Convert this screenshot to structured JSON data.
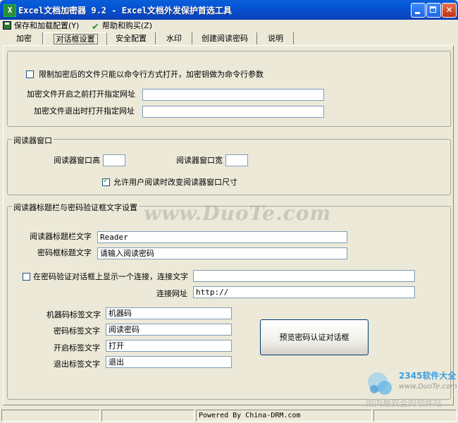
{
  "window": {
    "title": "Excel文档加密器 9.2 - Excel文档外发保护首选工具",
    "icon_text": "X"
  },
  "menu": {
    "items": [
      {
        "label": "保存和加载配置(Y)",
        "icon": "save-icon"
      },
      {
        "label": "帮助和购买(Z)",
        "icon": "help-icon"
      }
    ]
  },
  "tabs": [
    "加密",
    "对话框设置",
    "安全配置",
    "水印",
    "创建阅读密码",
    "说明"
  ],
  "active_tab": "对话框设置",
  "section_cmd": {
    "restrict_label": "限制加密后的文件只能以命令行方式打开，加密钥做为命令行参数",
    "restrict_checked": false,
    "open_url_label": "加密文件开启之前打开指定网址",
    "open_url_value": "",
    "exit_url_label": "加密文件退出时打开指定网址",
    "exit_url_value": ""
  },
  "reader_window": {
    "title": "阅读器窗口",
    "height_label": "阅读器窗口高",
    "height_value": "",
    "width_label": "阅读器窗口宽",
    "width_value": "",
    "allow_resize_label": "允许用户阅读时改变阅读器窗口尺寸",
    "allow_resize_checked": true
  },
  "title_text_settings": {
    "title": "阅读器标题栏与密码验证框文字设置",
    "reader_title_label": "阅读器标题栏文字",
    "reader_title_value": "Reader",
    "pwd_box_title_label": "密码框标题文字",
    "pwd_box_title_value": "请输入阅读密码",
    "show_link_label": "在密码验证对话框上显示一个连接，连接文字",
    "show_link_checked": false,
    "link_text_value": "",
    "link_url_label": "连接网址",
    "link_url_value": "http://",
    "machine_code_label": "机器码标签文字",
    "machine_code_value": "机器码",
    "password_label": "密码标签文字",
    "password_value": "阅读密码",
    "open_label": "开启标签文字",
    "open_value": "打开",
    "exit_label": "退出标签文字",
    "exit_value": "退出",
    "preview_button": "预览密码认证对话框"
  },
  "watermark": {
    "text": "www.DuoTe.com",
    "corner_brand": "2345软件大全",
    "corner_site": "www.DuoTe.com",
    "corner_slogan": "国内最安全的软件站"
  },
  "statusbar": {
    "panels": [
      "",
      "",
      "Powered By China-DRM.com",
      ""
    ]
  }
}
